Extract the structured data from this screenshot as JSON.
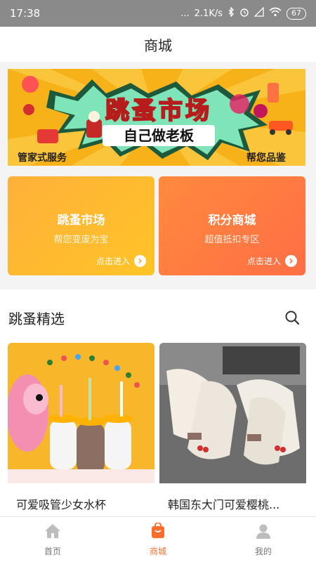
{
  "status_bar": {
    "time": "17:38",
    "signal_dots": "...",
    "net_speed": "2.1K/s",
    "battery": "67"
  },
  "header": {
    "title": "商城"
  },
  "banner": {
    "title": "跳蚤市场",
    "subtitle": "自己做老板",
    "left_caption": "管家式服务",
    "right_caption": "帮您品鉴"
  },
  "cards": [
    {
      "title": "跳蚤市场",
      "subtitle": "帮您变废为宝",
      "enter_label": "点击进入"
    },
    {
      "title": "积分商城",
      "subtitle": "超值抵扣专区",
      "enter_label": "点击进入"
    }
  ],
  "section": {
    "title": "跳蚤精选"
  },
  "products": [
    {
      "name": "可爱吸管少女水杯"
    },
    {
      "name": "韩国东大门可爱樱桃..."
    }
  ],
  "tabs": [
    {
      "label": "首页",
      "icon": "home-icon",
      "active": false
    },
    {
      "label": "商城",
      "icon": "shop-icon",
      "active": true
    },
    {
      "label": "我的",
      "icon": "user-icon",
      "active": false
    }
  ],
  "colors": {
    "accent": "#ff6d2d",
    "card_left": "#ffb53a",
    "card_right": "#ff7a40",
    "banner_bg": "#f7b21a"
  }
}
